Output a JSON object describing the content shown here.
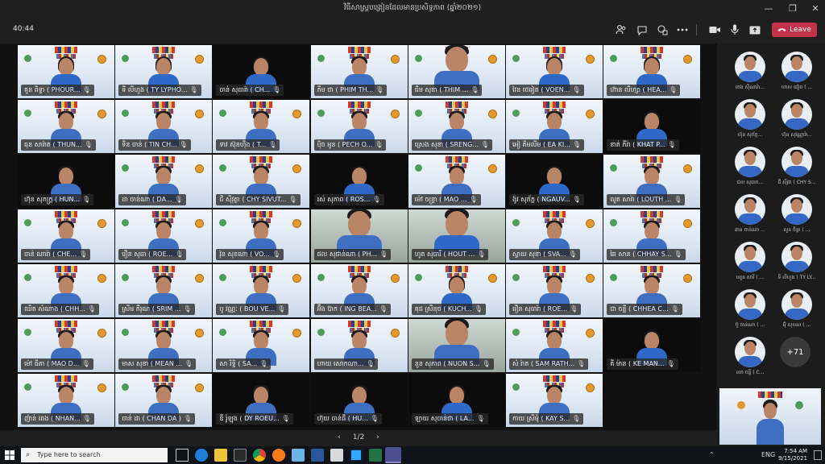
{
  "window": {
    "title": "វិធីសាស្ត្របង្រៀនដែលមានប្រសិទ្ធភាព (ឆ្នាំ២០២១)",
    "minimize": "—",
    "restore": "❐",
    "close": "✕"
  },
  "toolbar": {
    "timer": "40:44",
    "leave_label": "Leave",
    "icons": [
      "people-icon",
      "chat-icon",
      "react-icon",
      "more-icon",
      "camera-icon",
      "mic-icon",
      "share-icon"
    ]
  },
  "participants": [
    {
      "name": "គួន ពិទ្ធា ( PHOUR...",
      "muted": true
    },
    {
      "name": "ទី លីហួង ( TY LYPHO...",
      "muted": true
    },
    {
      "name": "ចាន់ សុធារ៉ា ( CH...",
      "muted": true
    },
    {
      "name": "ភឹម ថា ( PHIM TH...",
      "muted": true
    },
    {
      "name": "ធឹម សុខា ( THIM ...",
      "muted": true
    },
    {
      "name": "វៃន ថេរៀត ( VOEN...",
      "muted": true
    },
    {
      "name": "ហ៊ាន លីហ្សា ( HEA...",
      "muted": true
    },
    {
      "name": "ធុន សារ៉ាត ( THUN...",
      "muted": true
    },
    {
      "name": "ទីន ចាន់ ( TIN CH...",
      "muted": true
    },
    {
      "name": "ទាវ ស៊ុនហ៊ឹង ( T...",
      "muted": true
    },
    {
      "name": "ប៉ិច អូន ( PECH O...",
      "muted": true
    },
    {
      "name": "ស្រេង សុខា ( SRENG...",
      "muted": true
    },
    {
      "name": "អៀ គីមលីម ( EA KI...",
      "muted": true
    },
    {
      "name": "ខាត់ ភីរ៉ា ( KHAT P...",
      "muted": true
    },
    {
      "name": "ហ៊ុន សុភក្ត្រ ( HUN...",
      "muted": true
    },
    {
      "name": "ដា ចាន់ណា ( DA...",
      "muted": true
    },
    {
      "name": "ជី ស៊ីវុត្ថា ( CHY SIVUT...",
      "muted": true
    },
    {
      "name": "រស់ សុភាព ( ROS...",
      "muted": true
    },
    {
      "name": "ម៉ៅ ចន្ទ្រា ( MAO ...",
      "muted": true
    },
    {
      "name": "ង៉ូវ សុភ័ក្ត ( NGAUV...",
      "muted": true
    },
    {
      "name": "លូត សារ៉ា ( LOUTH ...",
      "muted": true
    },
    {
      "name": "ចាន់ ណារ៉ា ( CHE...",
      "muted": true
    },
    {
      "name": "រឿន សុធា ( ROE...",
      "muted": true
    },
    {
      "name": "វ៉ុន សុខណា ( VO...",
      "muted": true
    },
    {
      "name": "ផល សុផាន់ណា ( PH...",
      "muted": true
    },
    {
      "name": "ហូត សុធារី ( HOUT ...",
      "muted": true
    },
    {
      "name": "ស្វាយ សុខា ( SVA...",
      "muted": true
    },
    {
      "name": "ឆៃ សាន ( CHHAY S...",
      "muted": true
    },
    {
      "name": "ឈិត សំណាង ( CHH...",
      "muted": true
    },
    {
      "name": "ស្រីម ភីរុណ ( SRIM ...",
      "muted": true
    },
    {
      "name": "បូ វណ្ណៈ ( BOU VE...",
      "muted": true
    },
    {
      "name": "អ៊ឹង ប៊ាក ( ING BEA...",
      "muted": true
    },
    {
      "name": "គុជ ស្រីនុច ( KUCH...",
      "muted": true
    },
    {
      "name": "រឿន សុធារ៉ា ( ROE...",
      "muted": true
    },
    {
      "name": "ជា ចន្ទី ( CHHEA C...",
      "muted": true
    },
    {
      "name": "ម៉ៅ ធីតា ( MAO D...",
      "muted": true
    },
    {
      "name": "មាស សុខា ( MEAN ...",
      "muted": true
    },
    {
      "name": "សា រិទ្ធិ ( SA...",
      "muted": true
    },
    {
      "name": "ហាយ សោភណា...",
      "muted": true
    },
    {
      "name": "នួន សុភាព ( NUON S...",
      "muted": true
    },
    {
      "name": "សំ រ៉ាត ( SAM RATH...",
      "muted": true
    },
    {
      "name": "គី ម៉ាន ( KE MAN...",
      "muted": true
    },
    {
      "name": "ញ៉ាន់ ឆេង ( NHAN...",
      "muted": true
    },
    {
      "name": "ចាន់ ដា ( CHAN DA )",
      "muted": true
    },
    {
      "name": "ឌី រ៉ូឡុង ( DY ROEU...",
      "muted": true
    },
    {
      "name": "ហ៊ុយ ចាន់ធី ( HU...",
      "muted": true
    },
    {
      "name": "ឡាយ សុចាន់ថា ( LA...",
      "muted": true
    },
    {
      "name": "កាយ ស្រីមុំ ( KAY S...",
      "muted": true
    }
  ],
  "sidebar": [
    {
      "name": "ចេង ស៊ីណារ៉ា..."
    },
    {
      "name": "ហាស ជៀត ( ..."
    },
    {
      "name": "ហ៊ុន សុភ័ក្ត..."
    },
    {
      "name": "ហ៊ុន សុវណ្ណារ៉ា..."
    },
    {
      "name": "ជល សុធាក..."
    },
    {
      "name": "ជី ស៊ីវុត ( CHY S..."
    },
    {
      "name": "ឆាន ចាន់ណា ..."
    },
    {
      "name": "សួន ចិន្តា ( ..."
    },
    {
      "name": "ឈួន សារី ( ..."
    },
    {
      "name": "ទី លីហួង ( TY LY..."
    },
    {
      "name": "ប៊ូ ចាន់ណា ( ..."
    },
    {
      "name": "អ៊ុំ សុខណ ( ..."
    },
    {
      "name": "ឈា ចន្ទី ( C..."
    }
  ],
  "more_count": "+71",
  "pager": {
    "prev": "‹",
    "label": "1/2",
    "next": "›"
  },
  "taskbar": {
    "search_placeholder": "Type here to search",
    "time": "7:54 AM",
    "date": "9/15/2021",
    "lang": "ENG"
  },
  "colors": {
    "leave": "#c4314b",
    "accent": "#6264a7"
  }
}
